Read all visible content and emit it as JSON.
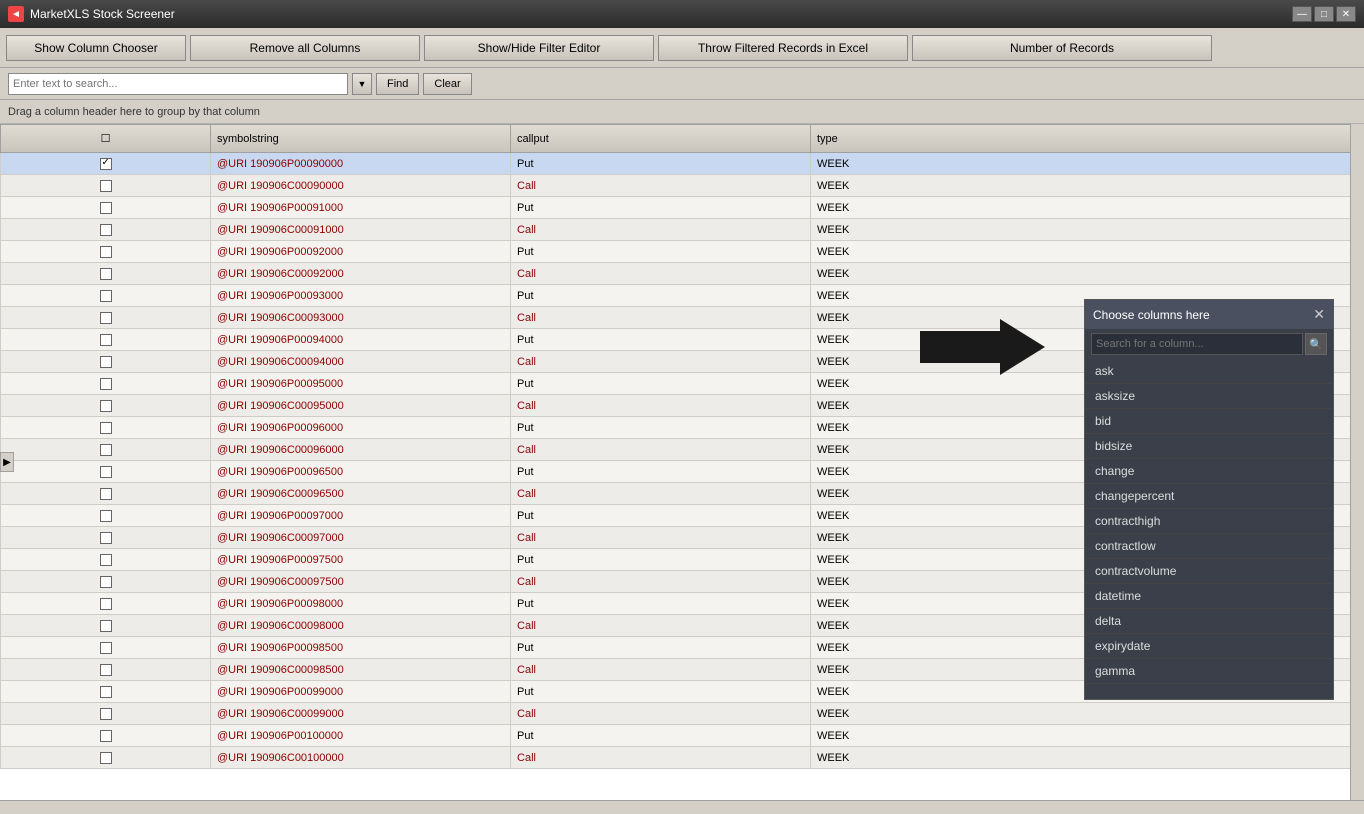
{
  "window": {
    "title": "MarketXLS Stock Screener",
    "icon": "◄"
  },
  "winControls": {
    "minimize": "—",
    "restore": "□",
    "close": "✕"
  },
  "toolbar": {
    "showColumnChooser": "Show Column Chooser",
    "removeAllColumns": "Remove all Columns",
    "showHideFilterEditor": "Show/Hide Filter Editor",
    "throwFilteredRecords": "Throw Filtered Records in Excel",
    "numberOfRecords": "Number of Records"
  },
  "searchBar": {
    "placeholder": "Enter text to search...",
    "dropdownArrow": "▼",
    "findLabel": "Find",
    "clearLabel": "Clear"
  },
  "dragHint": "Drag a column header here to group by that column",
  "tableHeaders": {
    "checkbox": "☐",
    "symbolstring": "symbolstring",
    "callput": "callput",
    "type": "type"
  },
  "tableRows": [
    {
      "id": 1,
      "checked": true,
      "symbol": "@URI  190906P00090000",
      "callput": "Put",
      "type": "WEEK",
      "callputType": "put"
    },
    {
      "id": 2,
      "checked": false,
      "symbol": "@URI  190906C00090000",
      "callput": "Call",
      "type": "WEEK",
      "callputType": "call"
    },
    {
      "id": 3,
      "checked": false,
      "symbol": "@URI  190906P00091000",
      "callput": "Put",
      "type": "WEEK",
      "callputType": "put"
    },
    {
      "id": 4,
      "checked": false,
      "symbol": "@URI  190906C00091000",
      "callput": "Call",
      "type": "WEEK",
      "callputType": "call"
    },
    {
      "id": 5,
      "checked": false,
      "symbol": "@URI  190906P00092000",
      "callput": "Put",
      "type": "WEEK",
      "callputType": "put"
    },
    {
      "id": 6,
      "checked": false,
      "symbol": "@URI  190906C00092000",
      "callput": "Call",
      "type": "WEEK",
      "callputType": "call"
    },
    {
      "id": 7,
      "checked": false,
      "symbol": "@URI  190906P00093000",
      "callput": "Put",
      "type": "WEEK",
      "callputType": "put"
    },
    {
      "id": 8,
      "checked": false,
      "symbol": "@URI  190906C00093000",
      "callput": "Call",
      "type": "WEEK",
      "callputType": "call"
    },
    {
      "id": 9,
      "checked": false,
      "symbol": "@URI  190906P00094000",
      "callput": "Put",
      "type": "WEEK",
      "callputType": "put"
    },
    {
      "id": 10,
      "checked": false,
      "symbol": "@URI  190906C00094000",
      "callput": "Call",
      "type": "WEEK",
      "callputType": "call"
    },
    {
      "id": 11,
      "checked": false,
      "symbol": "@URI  190906P00095000",
      "callput": "Put",
      "type": "WEEK",
      "callputType": "put"
    },
    {
      "id": 12,
      "checked": false,
      "symbol": "@URI  190906C00095000",
      "callput": "Call",
      "type": "WEEK",
      "callputType": "call"
    },
    {
      "id": 13,
      "checked": false,
      "symbol": "@URI  190906P00096000",
      "callput": "Put",
      "type": "WEEK",
      "callputType": "put"
    },
    {
      "id": 14,
      "checked": false,
      "symbol": "@URI  190906C00096000",
      "callput": "Call",
      "type": "WEEK",
      "callputType": "call"
    },
    {
      "id": 15,
      "checked": false,
      "symbol": "@URI  190906P00096500",
      "callput": "Put",
      "type": "WEEK",
      "callputType": "put"
    },
    {
      "id": 16,
      "checked": false,
      "symbol": "@URI  190906C00096500",
      "callput": "Call",
      "type": "WEEK",
      "callputType": "call"
    },
    {
      "id": 17,
      "checked": false,
      "symbol": "@URI  190906P00097000",
      "callput": "Put",
      "type": "WEEK",
      "callputType": "put"
    },
    {
      "id": 18,
      "checked": false,
      "symbol": "@URI  190906C00097000",
      "callput": "Call",
      "type": "WEEK",
      "callputType": "call"
    },
    {
      "id": 19,
      "checked": false,
      "symbol": "@URI  190906P00097500",
      "callput": "Put",
      "type": "WEEK",
      "callputType": "put"
    },
    {
      "id": 20,
      "checked": false,
      "symbol": "@URI  190906C00097500",
      "callput": "Call",
      "type": "WEEK",
      "callputType": "call"
    },
    {
      "id": 21,
      "checked": false,
      "symbol": "@URI  190906P00098000",
      "callput": "Put",
      "type": "WEEK",
      "callputType": "put"
    },
    {
      "id": 22,
      "checked": false,
      "symbol": "@URI  190906C00098000",
      "callput": "Call",
      "type": "WEEK",
      "callputType": "call"
    },
    {
      "id": 23,
      "checked": false,
      "symbol": "@URI  190906P00098500",
      "callput": "Put",
      "type": "WEEK",
      "callputType": "put"
    },
    {
      "id": 24,
      "checked": false,
      "symbol": "@URI  190906C00098500",
      "callput": "Call",
      "type": "WEEK",
      "callputType": "call"
    },
    {
      "id": 25,
      "checked": false,
      "symbol": "@URI  190906P00099000",
      "callput": "Put",
      "type": "WEEK",
      "callputType": "put"
    },
    {
      "id": 26,
      "checked": false,
      "symbol": "@URI  190906C00099000",
      "callput": "Call",
      "type": "WEEK",
      "callputType": "call"
    },
    {
      "id": 27,
      "checked": false,
      "symbol": "@URI  190906P00100000",
      "callput": "Put",
      "type": "WEEK",
      "callputType": "put"
    },
    {
      "id": 28,
      "checked": false,
      "symbol": "@URI  190906C00100000",
      "callput": "Call",
      "type": "WEEK",
      "callputType": "call"
    }
  ],
  "colChooser": {
    "title": "Choose columns here",
    "searchPlaceholder": "Search for a column...",
    "searchIcon": "🔍",
    "closeIcon": "✕",
    "columns": [
      "ask",
      "asksize",
      "bid",
      "bidsize",
      "change",
      "changepercent",
      "contracthigh",
      "contractlow",
      "contractvolume",
      "datetime",
      "delta",
      "expirydate",
      "gamma"
    ]
  }
}
